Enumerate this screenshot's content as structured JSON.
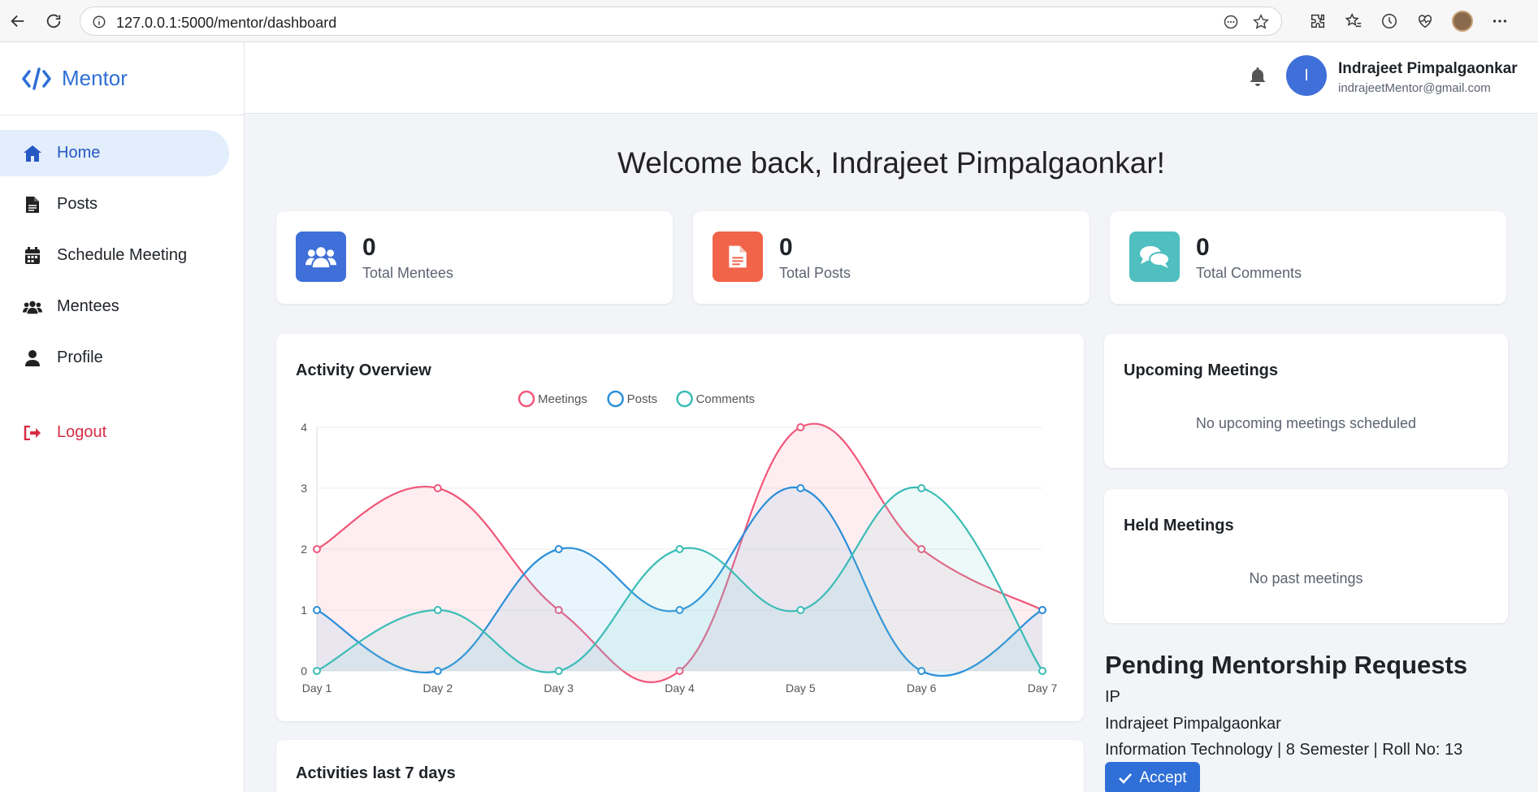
{
  "browser": {
    "url": "127.0.0.1:5000/mentor/dashboard"
  },
  "sidebar": {
    "brand": "Mentor",
    "items": [
      {
        "label": "Home",
        "icon": "home-icon",
        "active": true
      },
      {
        "label": "Posts",
        "icon": "document-icon",
        "active": false
      },
      {
        "label": "Schedule Meeting",
        "icon": "calendar-icon",
        "active": false
      },
      {
        "label": "Mentees",
        "icon": "users-icon",
        "active": false
      },
      {
        "label": "Profile",
        "icon": "user-icon",
        "active": false
      }
    ],
    "logout": "Logout"
  },
  "header": {
    "avatar_letter": "I",
    "user_name": "Indrajeet Pimpalgaonkar",
    "user_email": "indrajeetMentor@gmail.com"
  },
  "welcome": "Welcome back, Indrajeet Pimpalgaonkar!",
  "stats": [
    {
      "value": "0",
      "label": "Total Mentees",
      "color": "#3f6fd8",
      "icon": "users-icon"
    },
    {
      "value": "0",
      "label": "Total Posts",
      "color": "#f1644a",
      "icon": "file-icon"
    },
    {
      "value": "0",
      "label": "Total Comments",
      "color": "#4fbfc0",
      "icon": "comments-icon"
    }
  ],
  "activity": {
    "title": "Activity Overview"
  },
  "upcoming": {
    "title": "Upcoming Meetings",
    "empty": "No upcoming meetings scheduled"
  },
  "held": {
    "title": "Held Meetings",
    "empty": "No past meetings"
  },
  "activities_last": {
    "title": "Activities last 7 days"
  },
  "pending": {
    "title": "Pending Mentorship Requests",
    "initials": "IP",
    "name": "Indrajeet Pimpalgaonkar",
    "details": "Information Technology | 8 Semester | Roll No: 13",
    "accept_label": "Accept"
  },
  "chart_data": {
    "type": "line",
    "categories": [
      "Day 1",
      "Day 2",
      "Day 3",
      "Day 4",
      "Day 5",
      "Day 6",
      "Day 7"
    ],
    "ylim": [
      0,
      4
    ],
    "yticks": [
      0,
      1,
      2,
      3,
      4
    ],
    "legend_position": "top",
    "grid": true,
    "series": [
      {
        "name": "Meetings",
        "values": [
          2,
          3,
          1,
          0,
          4,
          2,
          1
        ],
        "color": "#f0577a",
        "fill": "rgba(255,160,180,0.18)"
      },
      {
        "name": "Posts",
        "values": [
          1,
          0,
          2,
          1,
          3,
          0,
          1
        ],
        "color": "#2a8fd9",
        "fill": "rgba(120,190,235,0.16)"
      },
      {
        "name": "Comments",
        "values": [
          0,
          1,
          0,
          2,
          1,
          3,
          0
        ],
        "color": "#3bbcb6",
        "fill": "rgba(120,210,205,0.14)"
      }
    ]
  }
}
